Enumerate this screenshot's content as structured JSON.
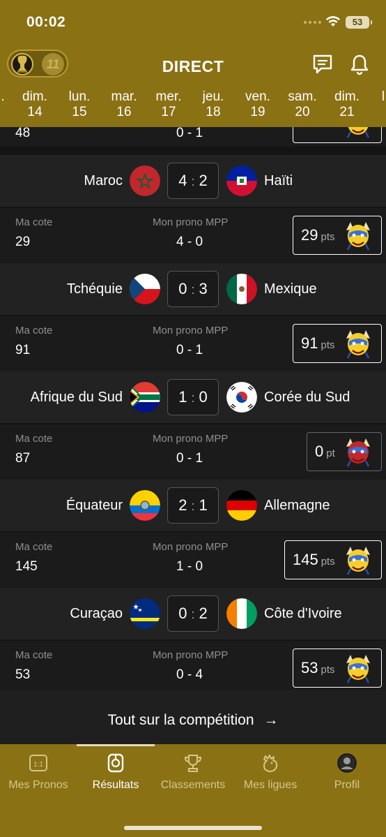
{
  "status": {
    "time": "00:02",
    "battery": "53"
  },
  "header": {
    "title": "DIRECT",
    "dates": [
      {
        "day": "dim.",
        "num": "14"
      },
      {
        "day": "lun.",
        "num": "15"
      },
      {
        "day": "mar.",
        "num": "16"
      },
      {
        "day": "mer.",
        "num": "17"
      },
      {
        "day": "jeu.",
        "num": "18"
      },
      {
        "day": "ven.",
        "num": "19"
      },
      {
        "day": "sam.",
        "num": "20"
      },
      {
        "day": "dim.",
        "num": "21"
      }
    ],
    "toggle_badge": "11"
  },
  "partial": {
    "cote": "48",
    "prono": "0 - 1"
  },
  "labels": {
    "cote": "Ma cote",
    "prono": "Mon prono MPP"
  },
  "matches": [
    {
      "home": "Maroc",
      "away": "Haïti",
      "home_score": "4",
      "away_score": "2",
      "cote": "29",
      "prono": "4 - 0",
      "points": "29",
      "unit": "pts"
    },
    {
      "home": "Tchéquie",
      "away": "Mexique",
      "home_score": "0",
      "away_score": "3",
      "cote": "91",
      "prono": "0 - 1",
      "points": "91",
      "unit": "pts"
    },
    {
      "home": "Afrique du Sud",
      "away": "Corée du Sud",
      "home_score": "1",
      "away_score": "0",
      "cote": "87",
      "prono": "0 - 1",
      "points": "0",
      "unit": "pt"
    },
    {
      "home": "Équateur",
      "away": "Allemagne",
      "home_score": "2",
      "away_score": "1",
      "cote": "145",
      "prono": "1 - 0",
      "points": "145",
      "unit": "pts"
    },
    {
      "home": "Curaçao",
      "away": "Côte d'Ivoire",
      "home_score": "0",
      "away_score": "2",
      "cote": "53",
      "prono": "0 - 4",
      "points": "53",
      "unit": "pts"
    }
  ],
  "more": {
    "label": "Tout sur la compétition",
    "arrow": "→"
  },
  "tabs": [
    {
      "label": "Mes Pronos",
      "icon": "scoreboard-icon"
    },
    {
      "label": "Résultats",
      "icon": "whistle-icon"
    },
    {
      "label": "Classements",
      "icon": "trophy-icon"
    },
    {
      "label": "Mes ligues",
      "icon": "rooster-icon"
    },
    {
      "label": "Profil",
      "icon": "avatar-icon"
    }
  ],
  "colors": {
    "gold": "#8a7114",
    "dark": "#141414"
  }
}
